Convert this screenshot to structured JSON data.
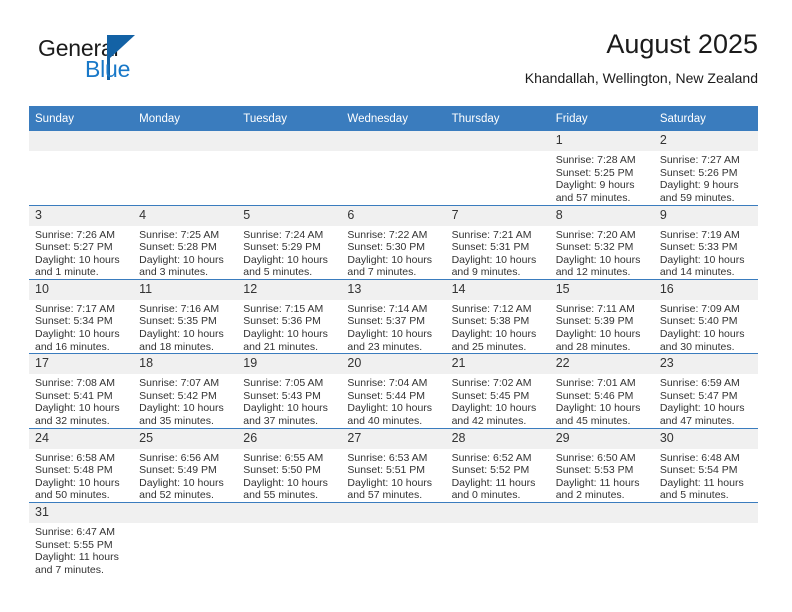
{
  "brand": {
    "name_part1": "General",
    "name_part2": "Blue",
    "logo_icon": "triangle-logo-icon",
    "color_dark": "#1b1b1b",
    "color_blue": "#1878c8",
    "color_triangle": "#1362a5"
  },
  "header": {
    "title": "August 2025",
    "subtitle": "Khandallah, Wellington, New Zealand"
  },
  "theme": {
    "header_blue": "#3a7cbe",
    "daynum_band": "#f0f0f0",
    "text": "#333333"
  },
  "calendar": {
    "weekday_headers": [
      "Sunday",
      "Monday",
      "Tuesday",
      "Wednesday",
      "Thursday",
      "Friday",
      "Saturday"
    ],
    "weeks": [
      [
        {
          "day": "",
          "empty": true,
          "sunrise": "",
          "sunset": "",
          "daylight_line1": "",
          "daylight_line2": ""
        },
        {
          "day": "",
          "empty": true,
          "sunrise": "",
          "sunset": "",
          "daylight_line1": "",
          "daylight_line2": ""
        },
        {
          "day": "",
          "empty": true,
          "sunrise": "",
          "sunset": "",
          "daylight_line1": "",
          "daylight_line2": ""
        },
        {
          "day": "",
          "empty": true,
          "sunrise": "",
          "sunset": "",
          "daylight_line1": "",
          "daylight_line2": ""
        },
        {
          "day": "",
          "empty": true,
          "sunrise": "",
          "sunset": "",
          "daylight_line1": "",
          "daylight_line2": ""
        },
        {
          "day": "1",
          "empty": false,
          "sunrise": "Sunrise: 7:28 AM",
          "sunset": "Sunset: 5:25 PM",
          "daylight_line1": "Daylight: 9 hours",
          "daylight_line2": "and 57 minutes."
        },
        {
          "day": "2",
          "empty": false,
          "sunrise": "Sunrise: 7:27 AM",
          "sunset": "Sunset: 5:26 PM",
          "daylight_line1": "Daylight: 9 hours",
          "daylight_line2": "and 59 minutes."
        }
      ],
      [
        {
          "day": "3",
          "empty": false,
          "sunrise": "Sunrise: 7:26 AM",
          "sunset": "Sunset: 5:27 PM",
          "daylight_line1": "Daylight: 10 hours",
          "daylight_line2": "and 1 minute."
        },
        {
          "day": "4",
          "empty": false,
          "sunrise": "Sunrise: 7:25 AM",
          "sunset": "Sunset: 5:28 PM",
          "daylight_line1": "Daylight: 10 hours",
          "daylight_line2": "and 3 minutes."
        },
        {
          "day": "5",
          "empty": false,
          "sunrise": "Sunrise: 7:24 AM",
          "sunset": "Sunset: 5:29 PM",
          "daylight_line1": "Daylight: 10 hours",
          "daylight_line2": "and 5 minutes."
        },
        {
          "day": "6",
          "empty": false,
          "sunrise": "Sunrise: 7:22 AM",
          "sunset": "Sunset: 5:30 PM",
          "daylight_line1": "Daylight: 10 hours",
          "daylight_line2": "and 7 minutes."
        },
        {
          "day": "7",
          "empty": false,
          "sunrise": "Sunrise: 7:21 AM",
          "sunset": "Sunset: 5:31 PM",
          "daylight_line1": "Daylight: 10 hours",
          "daylight_line2": "and 9 minutes."
        },
        {
          "day": "8",
          "empty": false,
          "sunrise": "Sunrise: 7:20 AM",
          "sunset": "Sunset: 5:32 PM",
          "daylight_line1": "Daylight: 10 hours",
          "daylight_line2": "and 12 minutes."
        },
        {
          "day": "9",
          "empty": false,
          "sunrise": "Sunrise: 7:19 AM",
          "sunset": "Sunset: 5:33 PM",
          "daylight_line1": "Daylight: 10 hours",
          "daylight_line2": "and 14 minutes."
        }
      ],
      [
        {
          "day": "10",
          "empty": false,
          "sunrise": "Sunrise: 7:17 AM",
          "sunset": "Sunset: 5:34 PM",
          "daylight_line1": "Daylight: 10 hours",
          "daylight_line2": "and 16 minutes."
        },
        {
          "day": "11",
          "empty": false,
          "sunrise": "Sunrise: 7:16 AM",
          "sunset": "Sunset: 5:35 PM",
          "daylight_line1": "Daylight: 10 hours",
          "daylight_line2": "and 18 minutes."
        },
        {
          "day": "12",
          "empty": false,
          "sunrise": "Sunrise: 7:15 AM",
          "sunset": "Sunset: 5:36 PM",
          "daylight_line1": "Daylight: 10 hours",
          "daylight_line2": "and 21 minutes."
        },
        {
          "day": "13",
          "empty": false,
          "sunrise": "Sunrise: 7:14 AM",
          "sunset": "Sunset: 5:37 PM",
          "daylight_line1": "Daylight: 10 hours",
          "daylight_line2": "and 23 minutes."
        },
        {
          "day": "14",
          "empty": false,
          "sunrise": "Sunrise: 7:12 AM",
          "sunset": "Sunset: 5:38 PM",
          "daylight_line1": "Daylight: 10 hours",
          "daylight_line2": "and 25 minutes."
        },
        {
          "day": "15",
          "empty": false,
          "sunrise": "Sunrise: 7:11 AM",
          "sunset": "Sunset: 5:39 PM",
          "daylight_line1": "Daylight: 10 hours",
          "daylight_line2": "and 28 minutes."
        },
        {
          "day": "16",
          "empty": false,
          "sunrise": "Sunrise: 7:09 AM",
          "sunset": "Sunset: 5:40 PM",
          "daylight_line1": "Daylight: 10 hours",
          "daylight_line2": "and 30 minutes."
        }
      ],
      [
        {
          "day": "17",
          "empty": false,
          "sunrise": "Sunrise: 7:08 AM",
          "sunset": "Sunset: 5:41 PM",
          "daylight_line1": "Daylight: 10 hours",
          "daylight_line2": "and 32 minutes."
        },
        {
          "day": "18",
          "empty": false,
          "sunrise": "Sunrise: 7:07 AM",
          "sunset": "Sunset: 5:42 PM",
          "daylight_line1": "Daylight: 10 hours",
          "daylight_line2": "and 35 minutes."
        },
        {
          "day": "19",
          "empty": false,
          "sunrise": "Sunrise: 7:05 AM",
          "sunset": "Sunset: 5:43 PM",
          "daylight_line1": "Daylight: 10 hours",
          "daylight_line2": "and 37 minutes."
        },
        {
          "day": "20",
          "empty": false,
          "sunrise": "Sunrise: 7:04 AM",
          "sunset": "Sunset: 5:44 PM",
          "daylight_line1": "Daylight: 10 hours",
          "daylight_line2": "and 40 minutes."
        },
        {
          "day": "21",
          "empty": false,
          "sunrise": "Sunrise: 7:02 AM",
          "sunset": "Sunset: 5:45 PM",
          "daylight_line1": "Daylight: 10 hours",
          "daylight_line2": "and 42 minutes."
        },
        {
          "day": "22",
          "empty": false,
          "sunrise": "Sunrise: 7:01 AM",
          "sunset": "Sunset: 5:46 PM",
          "daylight_line1": "Daylight: 10 hours",
          "daylight_line2": "and 45 minutes."
        },
        {
          "day": "23",
          "empty": false,
          "sunrise": "Sunrise: 6:59 AM",
          "sunset": "Sunset: 5:47 PM",
          "daylight_line1": "Daylight: 10 hours",
          "daylight_line2": "and 47 minutes."
        }
      ],
      [
        {
          "day": "24",
          "empty": false,
          "sunrise": "Sunrise: 6:58 AM",
          "sunset": "Sunset: 5:48 PM",
          "daylight_line1": "Daylight: 10 hours",
          "daylight_line2": "and 50 minutes."
        },
        {
          "day": "25",
          "empty": false,
          "sunrise": "Sunrise: 6:56 AM",
          "sunset": "Sunset: 5:49 PM",
          "daylight_line1": "Daylight: 10 hours",
          "daylight_line2": "and 52 minutes."
        },
        {
          "day": "26",
          "empty": false,
          "sunrise": "Sunrise: 6:55 AM",
          "sunset": "Sunset: 5:50 PM",
          "daylight_line1": "Daylight: 10 hours",
          "daylight_line2": "and 55 minutes."
        },
        {
          "day": "27",
          "empty": false,
          "sunrise": "Sunrise: 6:53 AM",
          "sunset": "Sunset: 5:51 PM",
          "daylight_line1": "Daylight: 10 hours",
          "daylight_line2": "and 57 minutes."
        },
        {
          "day": "28",
          "empty": false,
          "sunrise": "Sunrise: 6:52 AM",
          "sunset": "Sunset: 5:52 PM",
          "daylight_line1": "Daylight: 11 hours",
          "daylight_line2": "and 0 minutes."
        },
        {
          "day": "29",
          "empty": false,
          "sunrise": "Sunrise: 6:50 AM",
          "sunset": "Sunset: 5:53 PM",
          "daylight_line1": "Daylight: 11 hours",
          "daylight_line2": "and 2 minutes."
        },
        {
          "day": "30",
          "empty": false,
          "sunrise": "Sunrise: 6:48 AM",
          "sunset": "Sunset: 5:54 PM",
          "daylight_line1": "Daylight: 11 hours",
          "daylight_line2": "and 5 minutes."
        }
      ],
      [
        {
          "day": "31",
          "empty": false,
          "sunrise": "Sunrise: 6:47 AM",
          "sunset": "Sunset: 5:55 PM",
          "daylight_line1": "Daylight: 11 hours",
          "daylight_line2": "and 7 minutes."
        },
        {
          "day": "",
          "empty": true,
          "sunrise": "",
          "sunset": "",
          "daylight_line1": "",
          "daylight_line2": ""
        },
        {
          "day": "",
          "empty": true,
          "sunrise": "",
          "sunset": "",
          "daylight_line1": "",
          "daylight_line2": ""
        },
        {
          "day": "",
          "empty": true,
          "sunrise": "",
          "sunset": "",
          "daylight_line1": "",
          "daylight_line2": ""
        },
        {
          "day": "",
          "empty": true,
          "sunrise": "",
          "sunset": "",
          "daylight_line1": "",
          "daylight_line2": ""
        },
        {
          "day": "",
          "empty": true,
          "sunrise": "",
          "sunset": "",
          "daylight_line1": "",
          "daylight_line2": ""
        },
        {
          "day": "",
          "empty": true,
          "sunrise": "",
          "sunset": "",
          "daylight_line1": "",
          "daylight_line2": ""
        }
      ]
    ]
  }
}
